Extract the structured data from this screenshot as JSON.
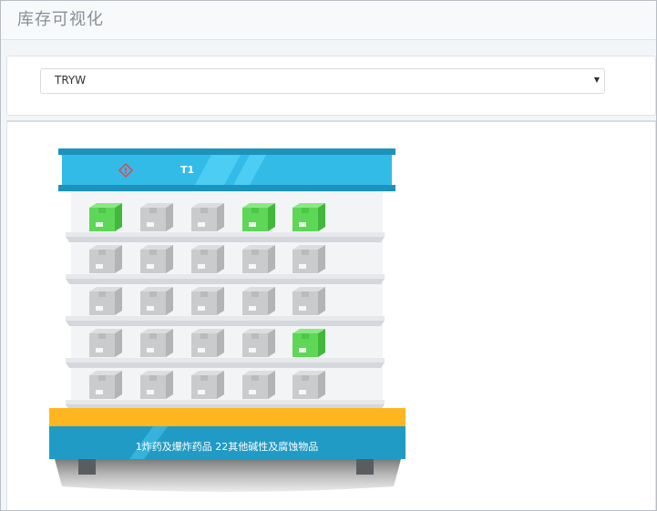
{
  "page": {
    "title": "库存可视化"
  },
  "filter": {
    "selected": "TRYW"
  },
  "rack": {
    "label": "T1",
    "description": "1炸药及爆炸药品 22其他碱性及腐蚀物品",
    "hazard_icon": "hazard-diamond-icon"
  },
  "boxes": [
    [
      "occupied",
      "empty",
      "empty",
      "occupied",
      "occupied"
    ],
    [
      "empty",
      "empty",
      "empty",
      "empty",
      "empty"
    ],
    [
      "empty",
      "empty",
      "empty",
      "empty",
      "empty"
    ],
    [
      "empty",
      "empty",
      "empty",
      "empty",
      "occupied"
    ],
    [
      "empty",
      "empty",
      "empty",
      "empty",
      "empty"
    ]
  ],
  "colors": {
    "header_blue": "#37c3ee",
    "header_dark": "#1ea6cf",
    "base_orange": "#fdb61f",
    "base_blue": "#209bc5",
    "box_occupied": "#5ed657",
    "box_empty": "#c9cbcd"
  }
}
